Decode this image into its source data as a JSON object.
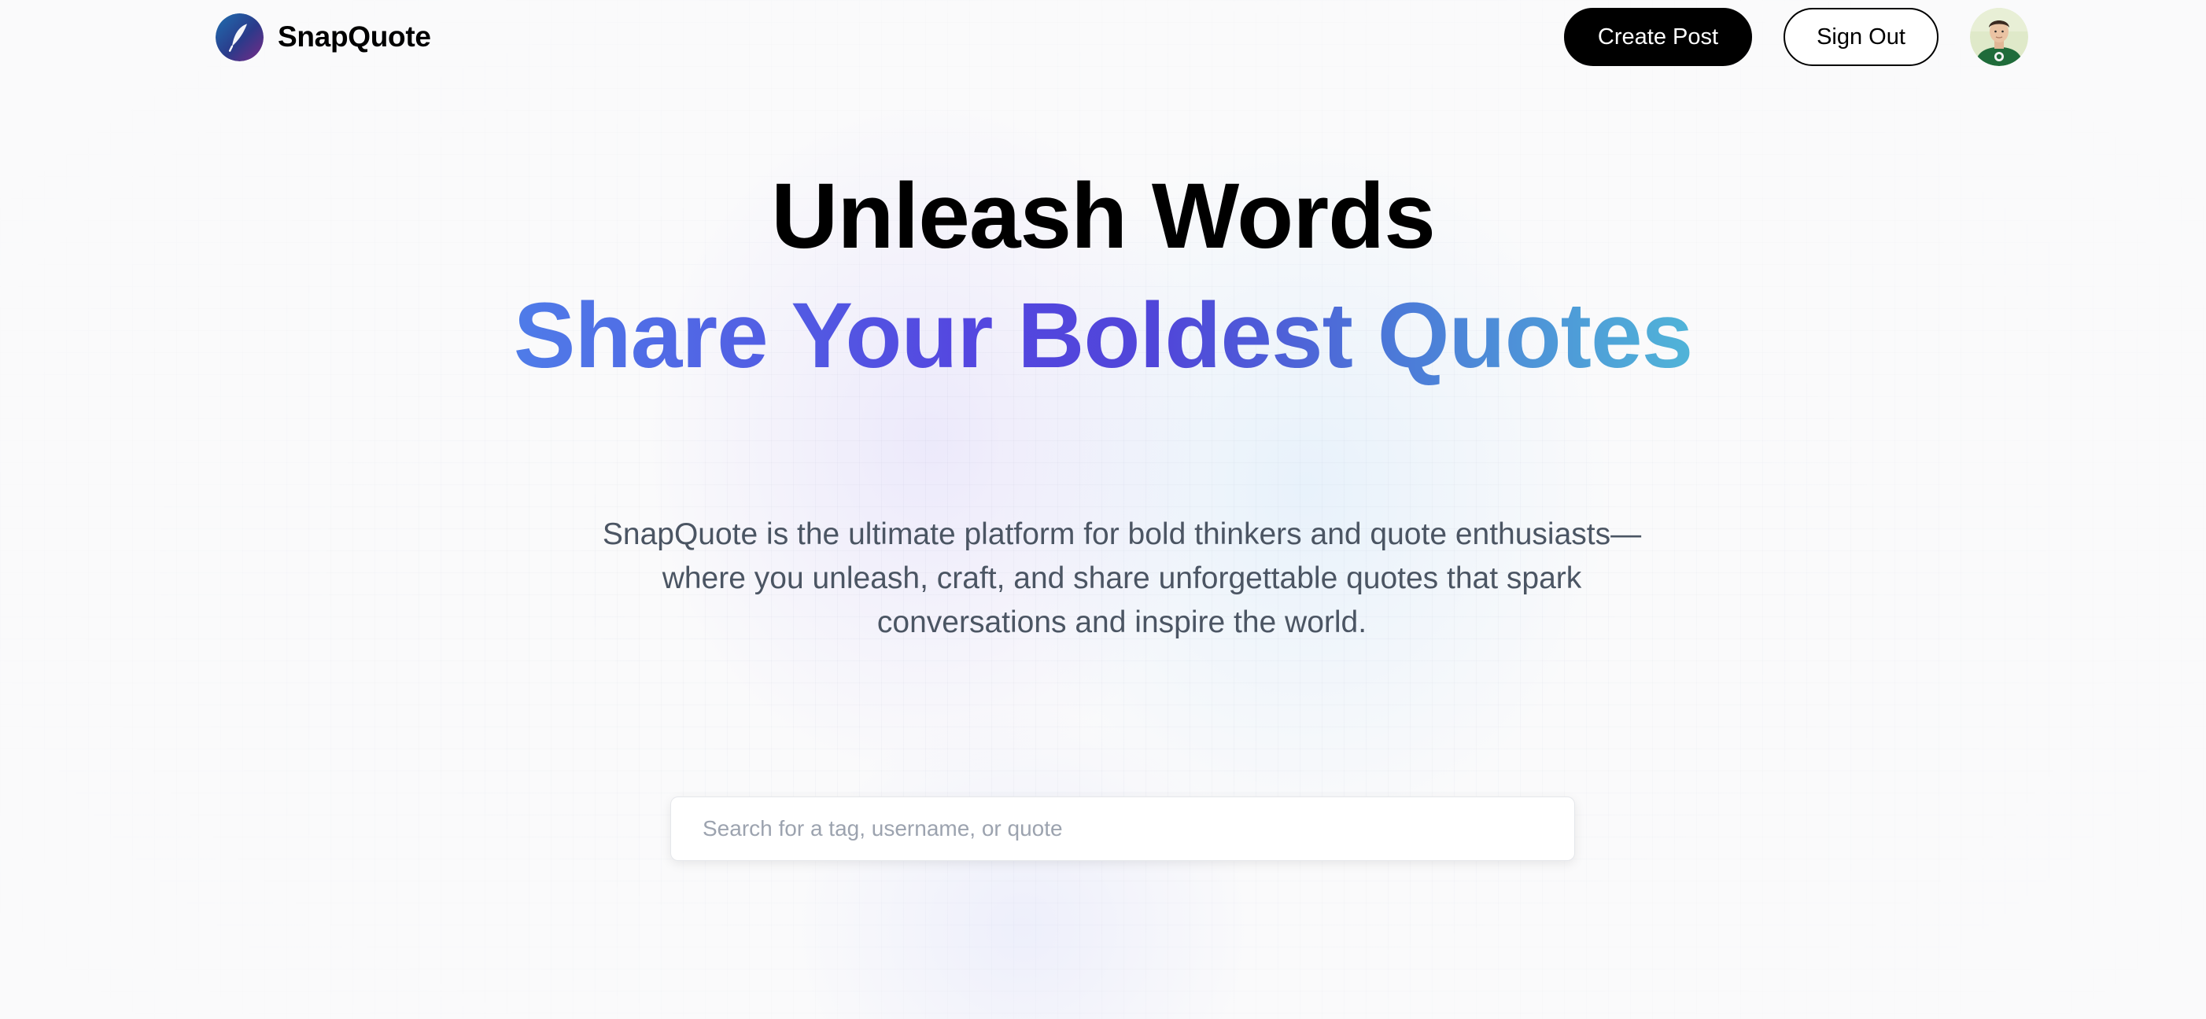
{
  "brand": {
    "name": "SnapQuote",
    "logo_icon": "feather-quill-logo-icon"
  },
  "nav": {
    "create_post": "Create Post",
    "sign_out": "Sign Out",
    "avatar_icon": "user-avatar-icon"
  },
  "hero": {
    "title_line1": "Unleash Words",
    "title_line2": "Share Your Boldest Quotes",
    "description": "SnapQuote is the ultimate platform for bold thinkers and quote enthusiasts—where you unleash, craft, and share unforgettable quotes that spark conversations and inspire the world."
  },
  "search": {
    "value": "",
    "placeholder": "Search for a tag, username, or quote"
  },
  "colors": {
    "primary_button": "#000000",
    "gradient_start": "#4f7ce8",
    "gradient_mid": "#5447e0",
    "gradient_end": "#50b4d8",
    "description_text": "#4b5563"
  }
}
